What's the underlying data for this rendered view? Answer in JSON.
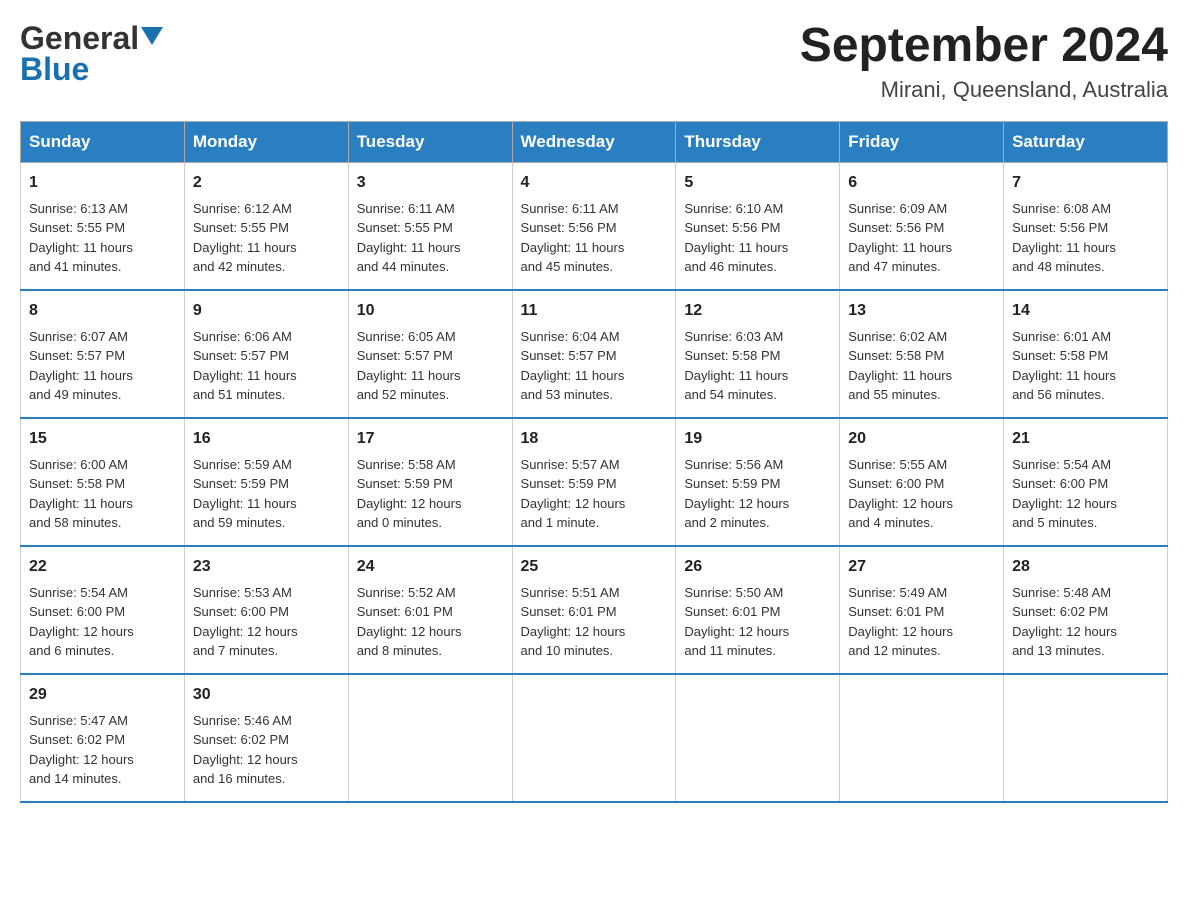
{
  "header": {
    "logo_general": "General",
    "logo_blue": "Blue",
    "month_title": "September 2024",
    "location": "Mirani, Queensland, Australia"
  },
  "days_of_week": [
    "Sunday",
    "Monday",
    "Tuesday",
    "Wednesday",
    "Thursday",
    "Friday",
    "Saturday"
  ],
  "weeks": [
    [
      {
        "day": "1",
        "sunrise": "6:13 AM",
        "sunset": "5:55 PM",
        "daylight": "11 hours and 41 minutes."
      },
      {
        "day": "2",
        "sunrise": "6:12 AM",
        "sunset": "5:55 PM",
        "daylight": "11 hours and 42 minutes."
      },
      {
        "day": "3",
        "sunrise": "6:11 AM",
        "sunset": "5:55 PM",
        "daylight": "11 hours and 44 minutes."
      },
      {
        "day": "4",
        "sunrise": "6:11 AM",
        "sunset": "5:56 PM",
        "daylight": "11 hours and 45 minutes."
      },
      {
        "day": "5",
        "sunrise": "6:10 AM",
        "sunset": "5:56 PM",
        "daylight": "11 hours and 46 minutes."
      },
      {
        "day": "6",
        "sunrise": "6:09 AM",
        "sunset": "5:56 PM",
        "daylight": "11 hours and 47 minutes."
      },
      {
        "day": "7",
        "sunrise": "6:08 AM",
        "sunset": "5:56 PM",
        "daylight": "11 hours and 48 minutes."
      }
    ],
    [
      {
        "day": "8",
        "sunrise": "6:07 AM",
        "sunset": "5:57 PM",
        "daylight": "11 hours and 49 minutes."
      },
      {
        "day": "9",
        "sunrise": "6:06 AM",
        "sunset": "5:57 PM",
        "daylight": "11 hours and 51 minutes."
      },
      {
        "day": "10",
        "sunrise": "6:05 AM",
        "sunset": "5:57 PM",
        "daylight": "11 hours and 52 minutes."
      },
      {
        "day": "11",
        "sunrise": "6:04 AM",
        "sunset": "5:57 PM",
        "daylight": "11 hours and 53 minutes."
      },
      {
        "day": "12",
        "sunrise": "6:03 AM",
        "sunset": "5:58 PM",
        "daylight": "11 hours and 54 minutes."
      },
      {
        "day": "13",
        "sunrise": "6:02 AM",
        "sunset": "5:58 PM",
        "daylight": "11 hours and 55 minutes."
      },
      {
        "day": "14",
        "sunrise": "6:01 AM",
        "sunset": "5:58 PM",
        "daylight": "11 hours and 56 minutes."
      }
    ],
    [
      {
        "day": "15",
        "sunrise": "6:00 AM",
        "sunset": "5:58 PM",
        "daylight": "11 hours and 58 minutes."
      },
      {
        "day": "16",
        "sunrise": "5:59 AM",
        "sunset": "5:59 PM",
        "daylight": "11 hours and 59 minutes."
      },
      {
        "day": "17",
        "sunrise": "5:58 AM",
        "sunset": "5:59 PM",
        "daylight": "12 hours and 0 minutes."
      },
      {
        "day": "18",
        "sunrise": "5:57 AM",
        "sunset": "5:59 PM",
        "daylight": "12 hours and 1 minute."
      },
      {
        "day": "19",
        "sunrise": "5:56 AM",
        "sunset": "5:59 PM",
        "daylight": "12 hours and 2 minutes."
      },
      {
        "day": "20",
        "sunrise": "5:55 AM",
        "sunset": "6:00 PM",
        "daylight": "12 hours and 4 minutes."
      },
      {
        "day": "21",
        "sunrise": "5:54 AM",
        "sunset": "6:00 PM",
        "daylight": "12 hours and 5 minutes."
      }
    ],
    [
      {
        "day": "22",
        "sunrise": "5:54 AM",
        "sunset": "6:00 PM",
        "daylight": "12 hours and 6 minutes."
      },
      {
        "day": "23",
        "sunrise": "5:53 AM",
        "sunset": "6:00 PM",
        "daylight": "12 hours and 7 minutes."
      },
      {
        "day": "24",
        "sunrise": "5:52 AM",
        "sunset": "6:01 PM",
        "daylight": "12 hours and 8 minutes."
      },
      {
        "day": "25",
        "sunrise": "5:51 AM",
        "sunset": "6:01 PM",
        "daylight": "12 hours and 10 minutes."
      },
      {
        "day": "26",
        "sunrise": "5:50 AM",
        "sunset": "6:01 PM",
        "daylight": "12 hours and 11 minutes."
      },
      {
        "day": "27",
        "sunrise": "5:49 AM",
        "sunset": "6:01 PM",
        "daylight": "12 hours and 12 minutes."
      },
      {
        "day": "28",
        "sunrise": "5:48 AM",
        "sunset": "6:02 PM",
        "daylight": "12 hours and 13 minutes."
      }
    ],
    [
      {
        "day": "29",
        "sunrise": "5:47 AM",
        "sunset": "6:02 PM",
        "daylight": "12 hours and 14 minutes."
      },
      {
        "day": "30",
        "sunrise": "5:46 AM",
        "sunset": "6:02 PM",
        "daylight": "12 hours and 16 minutes."
      },
      null,
      null,
      null,
      null,
      null
    ]
  ],
  "labels": {
    "sunrise": "Sunrise:",
    "sunset": "Sunset:",
    "daylight": "Daylight:"
  }
}
